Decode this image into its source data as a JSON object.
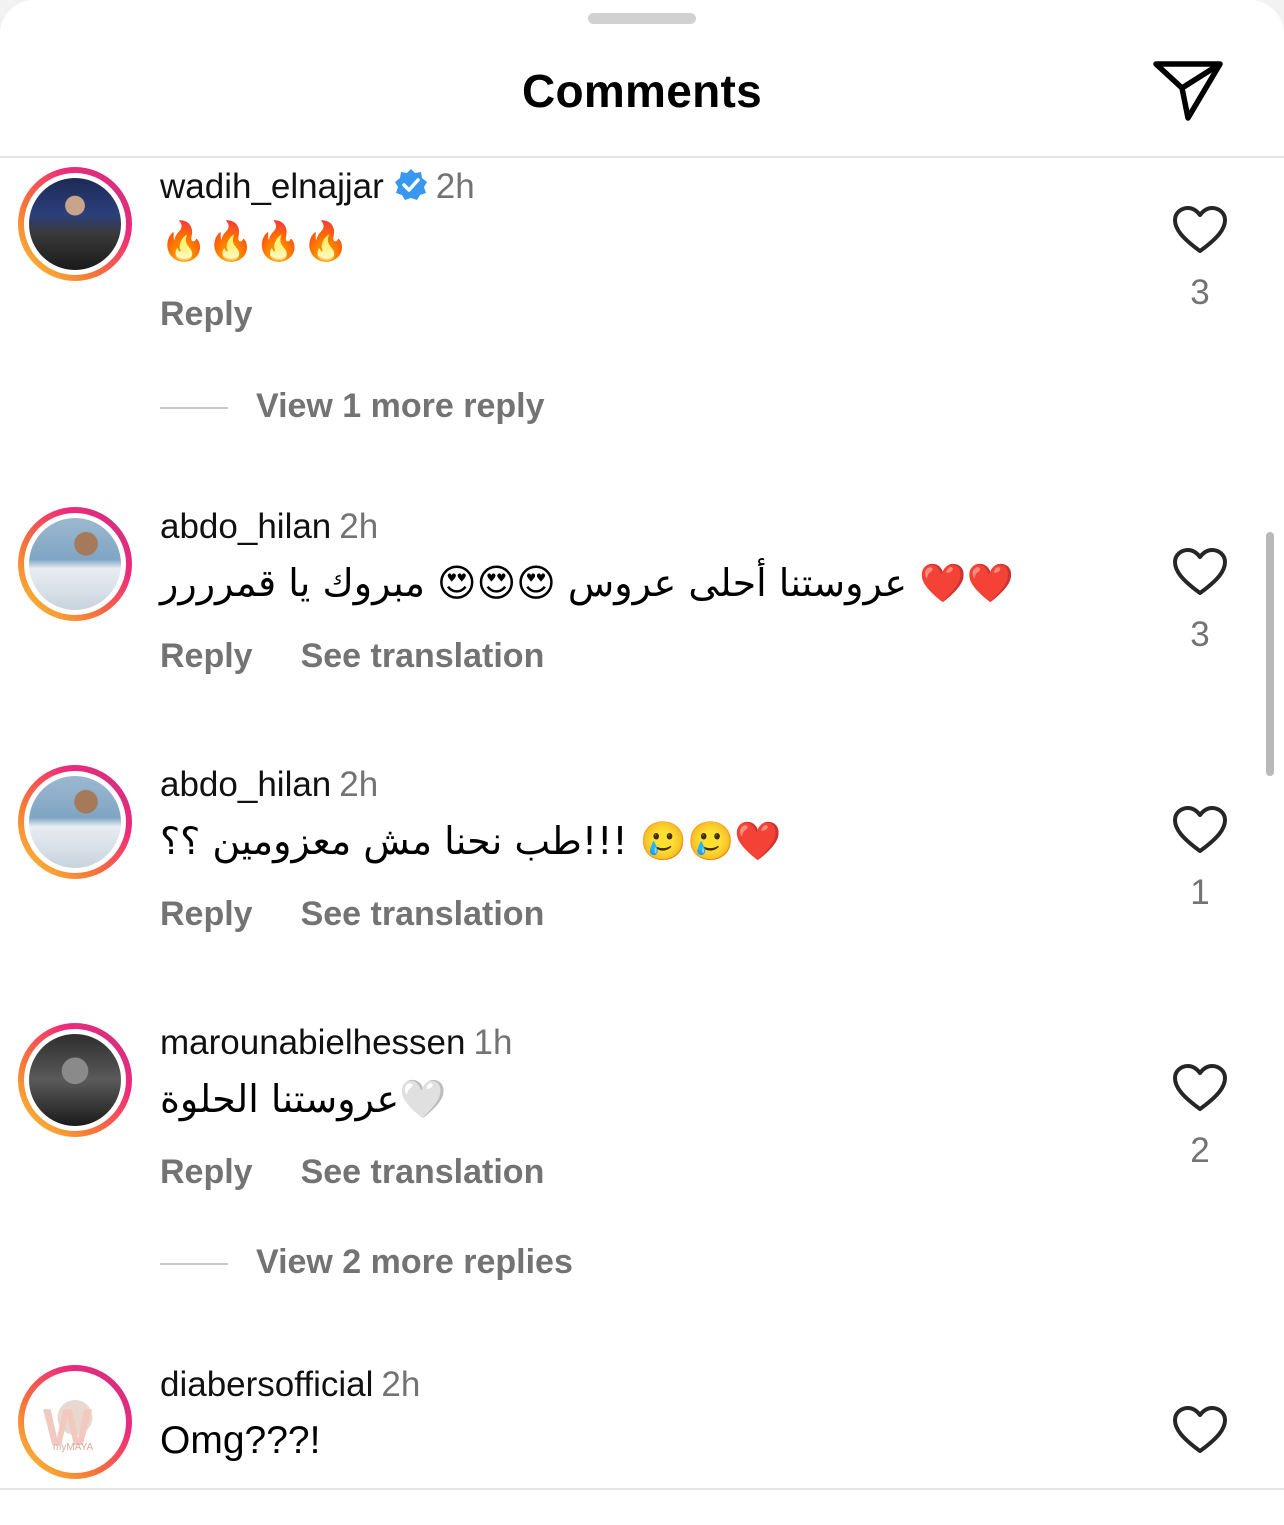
{
  "header": {
    "title": "Comments",
    "share_icon": "paper-plane-icon"
  },
  "comments": [
    {
      "username": "wadih_elnajjar",
      "verified": true,
      "time": "2h",
      "text": "🔥🔥🔥🔥",
      "reply": "Reply",
      "likes": "3",
      "more_replies": "View 1 more reply"
    },
    {
      "username": "abdo_hilan",
      "verified": false,
      "time": "2h",
      "text": "عروستنا أحلى عروس 😍😍😍 مبروك يا قمرررر ❤️❤️",
      "reply": "Reply",
      "translate": "See translation",
      "likes": "3"
    },
    {
      "username": "abdo_hilan",
      "verified": false,
      "time": "2h",
      "text": "طب نحنا مش معزومين ؟؟!!! 🥲🥲❤️",
      "reply": "Reply",
      "translate": "See translation",
      "likes": "1"
    },
    {
      "username": "marounabielhessen",
      "verified": false,
      "time": "1h",
      "text": "عروستنا الحلوة🤍",
      "reply": "Reply",
      "translate": "See translation",
      "likes": "2",
      "more_replies": "View 2 more replies"
    },
    {
      "username": "diabersofficial",
      "verified": false,
      "time": "2h",
      "text": "Omg???!",
      "likes": ""
    }
  ],
  "colors": {
    "accent_verified": "#3897f0",
    "secondary_text": "#737373"
  }
}
